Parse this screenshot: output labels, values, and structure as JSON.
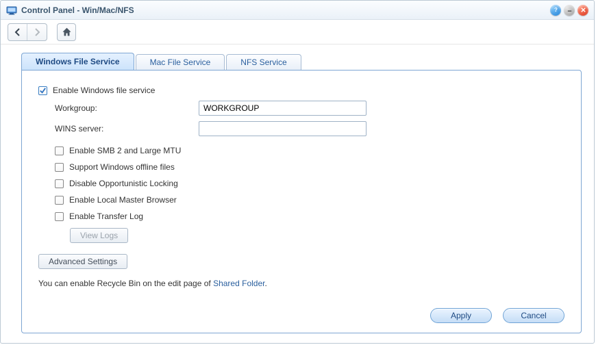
{
  "window": {
    "title": "Control Panel - Win/Mac/NFS"
  },
  "toolbar": {
    "back_enabled": true,
    "forward_enabled": false
  },
  "tabs": [
    {
      "label": "Windows File Service",
      "active": true
    },
    {
      "label": "Mac File Service",
      "active": false
    },
    {
      "label": "NFS Service",
      "active": false
    }
  ],
  "form": {
    "enable_service": {
      "label": "Enable Windows file service",
      "checked": true
    },
    "workgroup": {
      "label": "Workgroup:",
      "value": "WORKGROUP"
    },
    "wins": {
      "label": "WINS server:",
      "value": ""
    },
    "options": {
      "smb2": {
        "label": "Enable SMB 2 and Large MTU",
        "checked": false
      },
      "offline": {
        "label": "Support Windows offline files",
        "checked": false
      },
      "oplock": {
        "label": "Disable Opportunistic Locking",
        "checked": false
      },
      "master": {
        "label": "Enable Local Master Browser",
        "checked": false
      },
      "transferlog": {
        "label": "Enable Transfer Log",
        "checked": false
      }
    },
    "view_logs_label": "View Logs",
    "advanced_label": "Advanced Settings",
    "hint_prefix": "You can enable Recycle Bin on the edit page of ",
    "hint_link": "Shared Folder",
    "hint_suffix": "."
  },
  "buttons": {
    "apply": "Apply",
    "cancel": "Cancel"
  }
}
